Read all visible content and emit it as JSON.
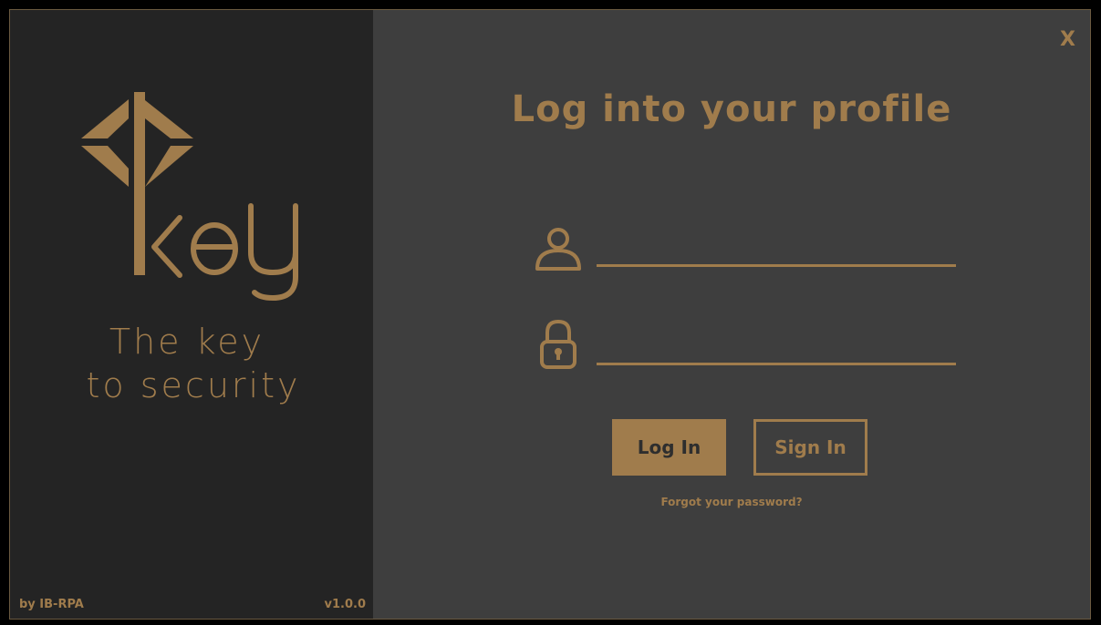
{
  "brand": {
    "logo_word": "key",
    "tagline_line1": "The key",
    "tagline_line2": "to security",
    "author": "by IB-RPA",
    "version": "v1.0.0",
    "accent_color": "#a07c4c"
  },
  "header": {
    "close_label": "X"
  },
  "login": {
    "title": "Log into your profile",
    "username_value": "",
    "password_value": "",
    "login_button": "Log In",
    "signin_button": "Sign In",
    "forgot_link": "Forgot your password?"
  },
  "icons": {
    "username": "user-icon",
    "password": "lock-icon",
    "logo": "key-logo"
  }
}
